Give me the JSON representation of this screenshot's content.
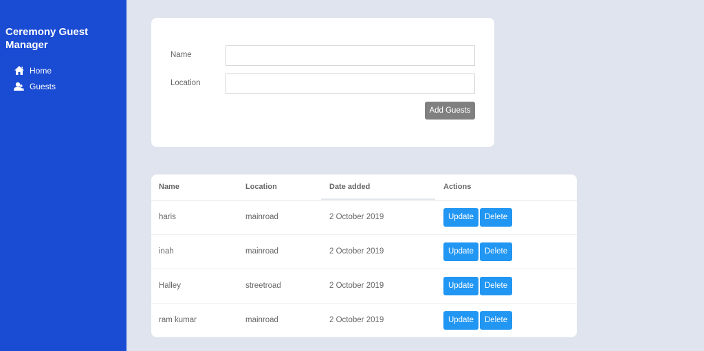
{
  "app": {
    "title": "Ceremony Guest Manager"
  },
  "sidebar": {
    "items": [
      {
        "label": "Home",
        "icon": "home-icon"
      },
      {
        "label": "Guests",
        "icon": "guests-icon"
      }
    ]
  },
  "form": {
    "name_label": "Name",
    "name_value": "",
    "location_label": "Location",
    "location_value": "",
    "submit_label": "Add Guests"
  },
  "table": {
    "columns": [
      "Name",
      "Location",
      "Date added",
      "Actions"
    ],
    "rows": [
      {
        "name": "haris",
        "location": "mainroad",
        "date": "2 October 2019"
      },
      {
        "name": "inah",
        "location": "mainroad",
        "date": "2 October 2019"
      },
      {
        "name": "Halley",
        "location": "streetroad",
        "date": "2 October 2019"
      },
      {
        "name": "ram kumar",
        "location": "mainroad",
        "date": "2 October 2019"
      }
    ],
    "update_label": "Update",
    "delete_label": "Delete"
  },
  "colors": {
    "sidebar": "#1a4bd3",
    "background": "#dfe4ee",
    "action_button": "#2196f3",
    "add_button": "#808080"
  }
}
